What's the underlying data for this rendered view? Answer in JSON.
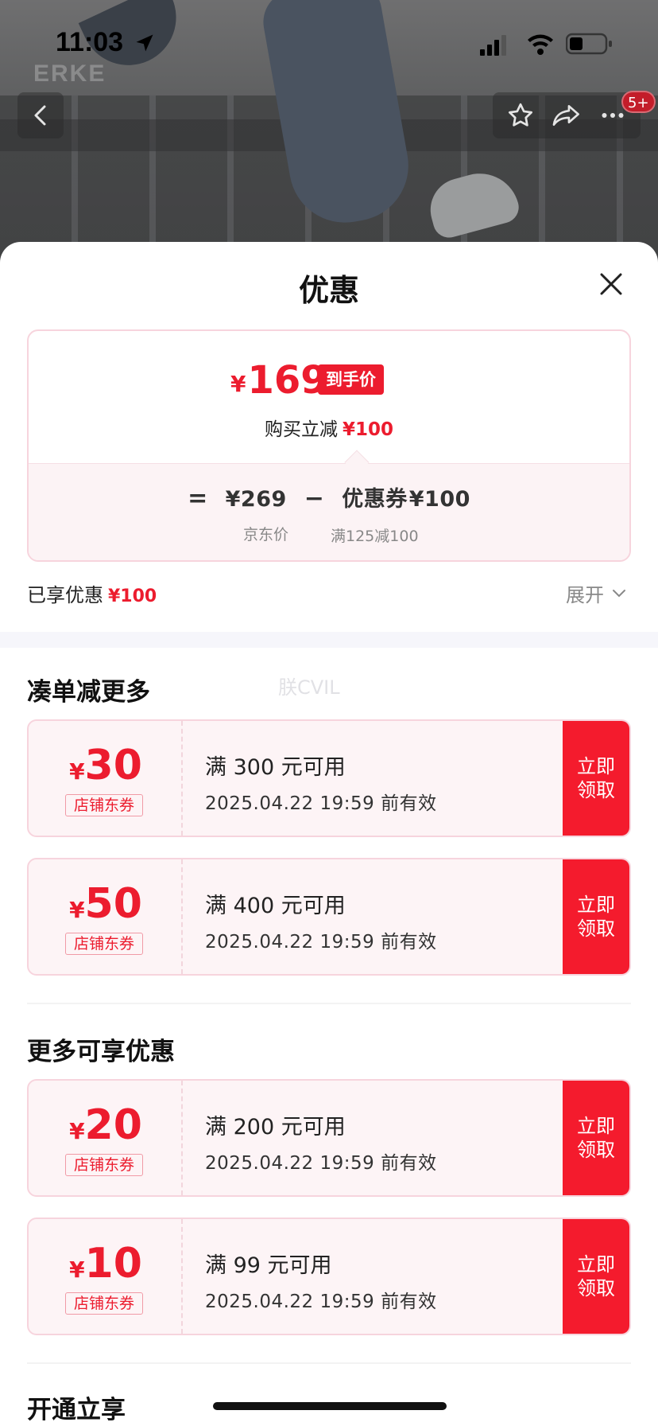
{
  "status_bar": {
    "time": "11:03"
  },
  "hero": {
    "brand_watermark": "ERKE",
    "cart_badge": "5+"
  },
  "sheet": {
    "title": "优惠"
  },
  "price_summary": {
    "currency": "¥",
    "final_price": "169",
    "final_tag": "到手价",
    "instant_label": "购买立减",
    "instant_amount": "¥100",
    "formula_equals": "=",
    "jd_price": "¥269",
    "minus": "−",
    "coupon_label": "优惠券",
    "coupon_amount": "¥100",
    "jd_price_label": "京东价",
    "coupon_rule": "满125减100"
  },
  "enjoyed": {
    "label": "已享优惠",
    "amount": "¥100",
    "expand_label": "展开"
  },
  "watermark_text": "朕CVIL",
  "sections": [
    {
      "title": "凑单减更多",
      "coupons": [
        {
          "symbol": "¥",
          "amount": "30",
          "type": "店铺东券",
          "condition": "满 300 元可用",
          "expiry": "2025.04.22 19:59 前有效",
          "action": "立即\n领取"
        },
        {
          "symbol": "¥",
          "amount": "50",
          "type": "店铺东券",
          "condition": "满 400 元可用",
          "expiry": "2025.04.22 19:59 前有效",
          "action": "立即\n领取"
        }
      ]
    },
    {
      "title": "更多可享优惠",
      "coupons": [
        {
          "symbol": "¥",
          "amount": "20",
          "type": "店铺东券",
          "condition": "满 200 元可用",
          "expiry": "2025.04.22 19:59 前有效",
          "action": "立即\n领取"
        },
        {
          "symbol": "¥",
          "amount": "10",
          "type": "店铺东券",
          "condition": "满 99 元可用",
          "expiry": "2025.04.22 19:59 前有效",
          "action": "立即\n领取"
        }
      ]
    },
    {
      "title": "开通立享"
    }
  ],
  "colors": {
    "accent": "#ec1c2e",
    "coupon_bg": "#fdf4f6",
    "coupon_border": "#f7d4dd"
  }
}
